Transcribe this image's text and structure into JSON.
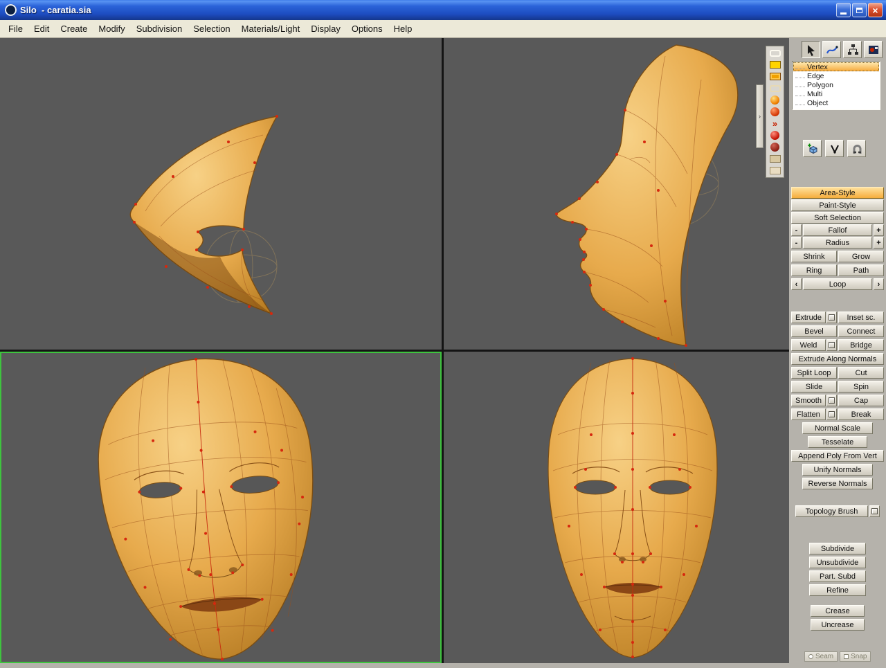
{
  "window": {
    "title": "Silo  - caratia.sia"
  },
  "menu": {
    "items": [
      "File",
      "Edit",
      "Create",
      "Modify",
      "Subdivision",
      "Selection",
      "Materials/Light",
      "Display",
      "Options",
      "Help"
    ]
  },
  "selection": {
    "modes": [
      "Vertex",
      "Edge",
      "Polygon",
      "Multi",
      "Object"
    ],
    "selected": "Vertex"
  },
  "panel": {
    "area_style": "Area-Style",
    "paint_style": "Paint-Style",
    "soft_selection": "Soft Selection",
    "fallof": "Fallof",
    "radius": "Radius",
    "minus": "-",
    "plus": "+",
    "shrink": "Shrink",
    "grow": "Grow",
    "ring": "Ring",
    "path": "Path",
    "loop": "Loop",
    "loop_prev": "‹",
    "loop_next": "›",
    "extrude": "Extrude",
    "inset": "Inset sc.",
    "bevel": "Bevel",
    "connect": "Connect",
    "weld": "Weld",
    "bridge": "Bridge",
    "extrude_along": "Extrude Along Normals",
    "split_loop": "Split Loop",
    "cut": "Cut",
    "slide": "Slide",
    "spin": "Spin",
    "smooth": "Smooth",
    "cap": "Cap",
    "flatten": "Flatten",
    "break": "Break",
    "normal_scale": "Normal Scale",
    "tesselate": "Tesselate",
    "append_poly": "Append Poly From Vert",
    "unify_normals": "Unify Normals",
    "reverse_normals": "Reverse Normals",
    "topology_brush": "Topology Brush",
    "subdivide": "Subdivide",
    "unsubdivide": "Unsubdivide",
    "part_subd": "Part. Subd",
    "refine": "Refine",
    "crease": "Crease",
    "uncrease": "Uncrease",
    "seam": "Seam",
    "snap": "Snap"
  },
  "palette": {
    "overflow_chevrons": "»",
    "handle_arrow": "›"
  },
  "icons": {
    "window": [
      "minimize-icon",
      "maximize-icon",
      "close-icon",
      "silo-logo-icon"
    ],
    "tools": [
      "select-arrow-icon",
      "tweak-brush-icon",
      "hierarchy-icon",
      "material-editor-icon"
    ],
    "panel": [
      "add-primitive-icon",
      "manipulator-icon",
      "magnet-icon",
      "option-box-icon"
    ],
    "palette": [
      "wireframe-frame-swatch",
      "yellow-swatch",
      "orange-swatch",
      "frame-swatch",
      "orange-sphere-swatch",
      "red-orange-sphere-swatch",
      "overflow-chevrons",
      "glossy-red-sphere-swatch",
      "dark-red-sphere-swatch",
      "tan-swatch",
      "light-tan-swatch"
    ]
  },
  "viewports": {
    "layout": "quad",
    "active": "bottom-left-perspective"
  },
  "colors": {
    "model": "#e2a44a",
    "wireframe": "#9a4f1a",
    "vertex_dots": "#d6280e",
    "viewport_bg": "#595959",
    "active_border": "#3ec43e",
    "accent_orange": "#f6ad3c",
    "titlebar_blue": "#2b63d9",
    "menubar": "#ece9d8",
    "panel_bg": "#b5b2ab"
  }
}
